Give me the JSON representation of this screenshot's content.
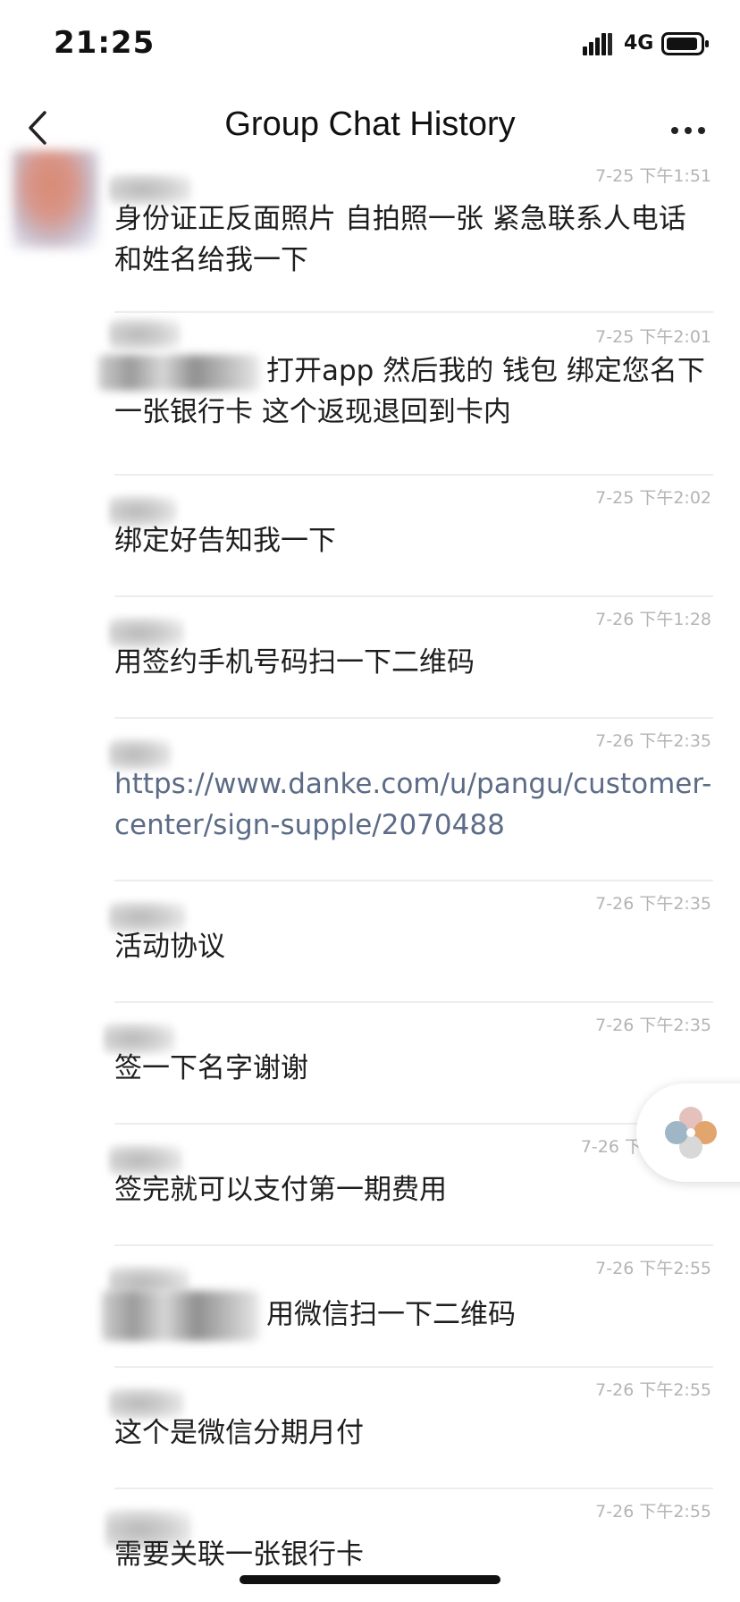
{
  "status_bar": {
    "time": "21:25",
    "network": "4G"
  },
  "nav": {
    "title": "Group Chat History"
  },
  "messages": [
    {
      "time": "7-25 下午1:51",
      "text": "身份证正反面照片 自拍照一张 紧急联系人电话和姓名给我一下"
    },
    {
      "time": "7-25 下午2:01",
      "text": "打开app 然后我的 钱包 绑定您名下一张银行卡 这个返现退回到卡内"
    },
    {
      "time": "7-25 下午2:02",
      "text": "绑定好告知我一下"
    },
    {
      "time": "7-26 下午1:28",
      "text": "用签约手机号码扫一下二维码"
    },
    {
      "time": "7-26 下午2:35",
      "text": "https://www.danke.com/u/pangu/customer-center/sign-supple/2070488"
    },
    {
      "time": "7-26 下午2:35",
      "text": "活动协议"
    },
    {
      "time": "7-26 下午2:35",
      "text": "签一下名字谢谢"
    },
    {
      "time": "7-26 下",
      "text": "签完就可以支付第一期费用"
    },
    {
      "time": "7-26 下午2:55",
      "text": "用微信扫一下二维码"
    },
    {
      "time": "7-26 下午2:55",
      "text": "这个是微信分期月付"
    },
    {
      "time": "7-26 下午2:55",
      "text": "需要关联一张银行卡"
    }
  ],
  "icons": {
    "back": "chevron-left-icon",
    "more": "more-horizontal-icon",
    "signal": "signal-icon",
    "battery": "battery-icon",
    "widget": "petal-logo-icon"
  },
  "colors": {
    "link": "#5c6b86",
    "timestamp": "#b4b4b4",
    "divider": "#ededed"
  }
}
